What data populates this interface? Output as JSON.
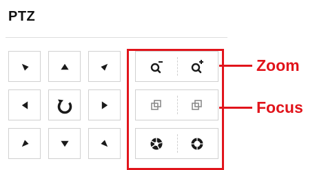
{
  "panel": {
    "title": "PTZ"
  },
  "direction_pad": [
    {
      "name": "pan-up-left-button",
      "icon": "arrow-up-left-icon"
    },
    {
      "name": "tilt-up-button",
      "icon": "arrow-up-icon"
    },
    {
      "name": "pan-up-right-button",
      "icon": "arrow-up-right-icon"
    },
    {
      "name": "pan-left-button",
      "icon": "arrow-left-icon"
    },
    {
      "name": "auto-pan-button",
      "icon": "rotate-icon"
    },
    {
      "name": "pan-right-button",
      "icon": "arrow-right-icon"
    },
    {
      "name": "pan-down-left-button",
      "icon": "arrow-down-left-icon"
    },
    {
      "name": "tilt-down-button",
      "icon": "arrow-down-icon"
    },
    {
      "name": "pan-down-right-button",
      "icon": "arrow-down-right-icon"
    }
  ],
  "lens_controls": {
    "zoom": {
      "left_icon": "zoom-out-icon",
      "right_icon": "zoom-in-icon"
    },
    "focus": {
      "left_icon": "focus-near-icon",
      "right_icon": "focus-far-icon"
    },
    "iris": {
      "left_icon": "iris-open-icon",
      "right_icon": "iris-close-icon"
    }
  },
  "annotations": {
    "zoom_label": "Zoom",
    "focus_label": "Focus"
  },
  "colors": {
    "highlight": "#e1141b",
    "icon": "#1a1a1a",
    "border": "#d0d0d0",
    "muted_icon": "#8a8a8a"
  }
}
